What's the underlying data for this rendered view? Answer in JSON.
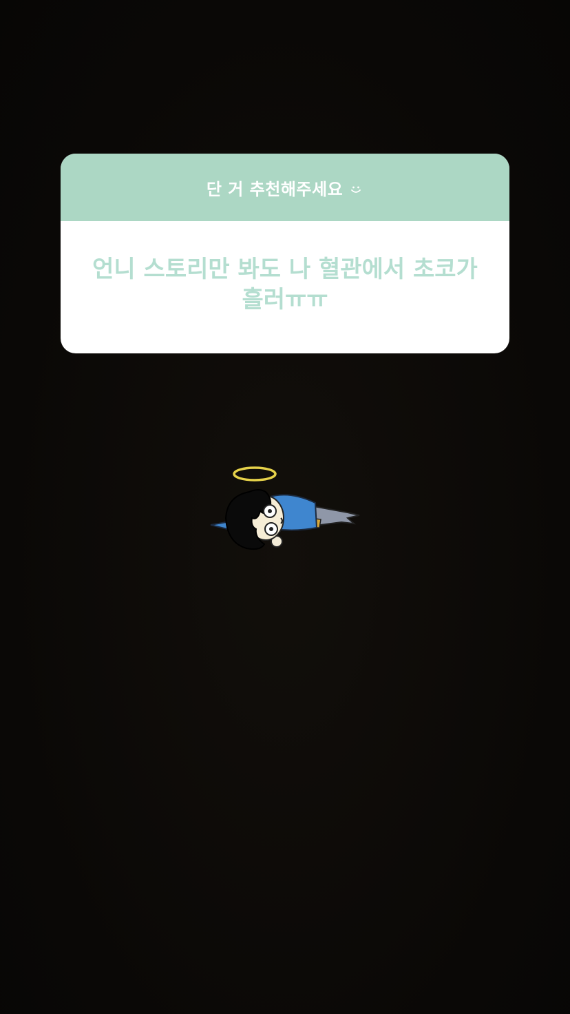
{
  "question": {
    "prompt": "단 거 추천해주세요",
    "emoji_icon": "smile-icon",
    "answer": "언니 스토리만 봐도 나 혈관에서 초코가 흘러ㅠㅠ"
  },
  "sticker": {
    "icon": "fainted-angel-character-sticker"
  },
  "colors": {
    "background": "#0b0907",
    "header": "#acd7c4",
    "answer_text": "#b4ded0"
  }
}
